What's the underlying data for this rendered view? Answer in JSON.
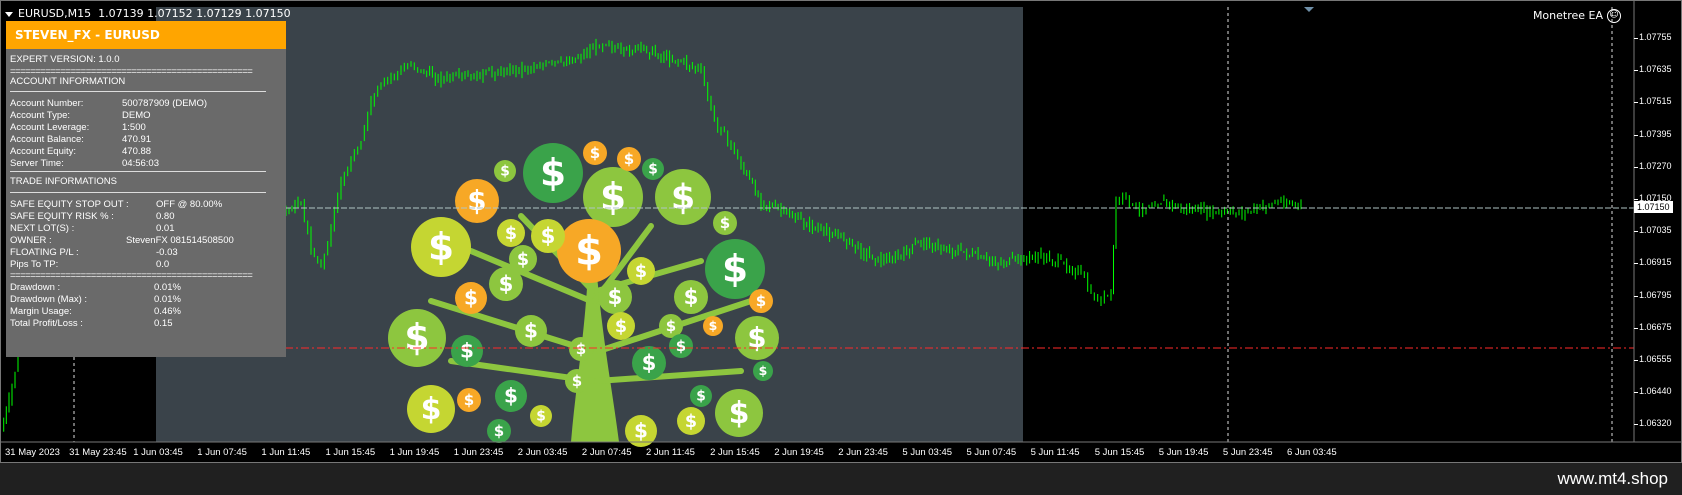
{
  "chart": {
    "symbol": "EURUSD,M15",
    "quote": "1.07139 1.07152 1.07129 1.07150",
    "ea_label": "Monetree EA",
    "current_price": "1.07150",
    "price_ticks": [
      "1.07755",
      "1.07635",
      "1.07515",
      "1.07395",
      "1.07270",
      "1.07150",
      "1.07035",
      "1.06915",
      "1.06795",
      "1.06675",
      "1.06555",
      "1.06440",
      "1.06320"
    ],
    "time_ticks": [
      "31 May 2023",
      "31 May 23:45",
      "1 Jun 03:45",
      "1 Jun 07:45",
      "1 Jun 11:45",
      "1 Jun 15:45",
      "1 Jun 19:45",
      "1 Jun 23:45",
      "2 Jun 03:45",
      "2 Jun 07:45",
      "2 Jun 11:45",
      "2 Jun 15:45",
      "2 Jun 19:45",
      "2 Jun 23:45",
      "5 Jun 03:45",
      "5 Jun 07:45",
      "5 Jun 11:45",
      "5 Jun 15:45",
      "5 Jun 19:45",
      "5 Jun 23:45",
      "6 Jun 03:45"
    ],
    "colors": {
      "candle": "#00ff00",
      "bid_line": "#b0c4c4",
      "stop_line": "#ff0000",
      "panel": "#6a6a6a",
      "header": "#ffa500",
      "logo_bg": "#3a434a"
    }
  },
  "panel": {
    "title": "STEVEN_FX - EURUSD",
    "expert_version": "EXPERT VERSION: 1.0.0",
    "separator": "================================================",
    "account_heading": "ACCOUNT INFORMATION",
    "account_rows": [
      {
        "label": "Account Number:",
        "value": "500787909 (DEMO)"
      },
      {
        "label": "Account Type:",
        "value": "DEMO"
      },
      {
        "label": "Account Leverage:",
        "value": "1:500"
      },
      {
        "label": "Account Balance:",
        "value": "470.91"
      },
      {
        "label": "Account Equity:",
        "value": "470.88"
      },
      {
        "label": "Server Time:",
        "value": "04:56:03"
      }
    ],
    "trade_heading": "TRADE INFORMATIONS",
    "trade_rows": [
      {
        "label": "SAFE EQUITY STOP OUT :",
        "value": "OFF  @ 80.00%"
      },
      {
        "label": "SAFE EQUITY RISK % :",
        "value": "0.80"
      },
      {
        "label": "NEXT LOT(S) :",
        "value": "0.01"
      },
      {
        "label": "OWNER :",
        "value": "StevenFX 081514508500"
      },
      {
        "label": "FLOATING P/L :",
        "value": "-0.03"
      },
      {
        "label": "Pips To TP:",
        "value": "0.0"
      }
    ],
    "stats_rows": [
      {
        "label": "Drawdown :",
        "value": "0.01%"
      },
      {
        "label": "Drawdown (Max) :",
        "value": "0.01%"
      },
      {
        "label": "Margin Usage:",
        "value": "0.46%"
      },
      {
        "label": "Total Profit/Loss :",
        "value": "0.15"
      }
    ]
  },
  "footer": {
    "brand": "www.mt4.shop"
  }
}
